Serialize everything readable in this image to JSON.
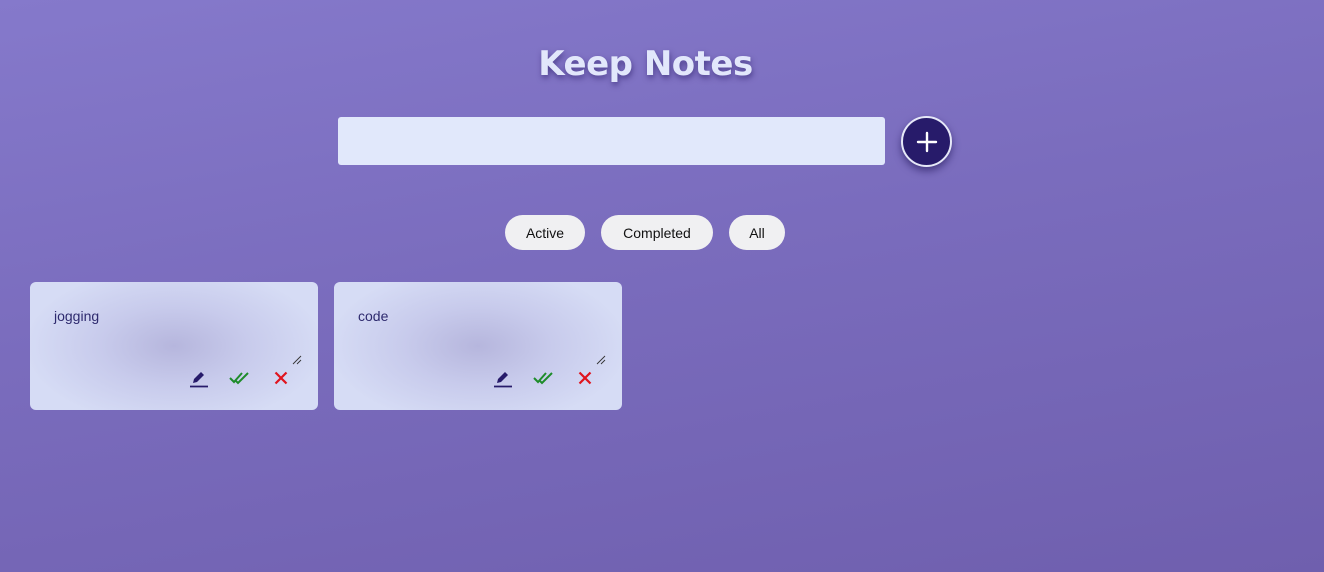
{
  "header": {
    "title": "Keep Notes"
  },
  "new_note": {
    "value": "",
    "placeholder": ""
  },
  "add_button": {
    "icon": "plus-icon"
  },
  "filters": [
    {
      "label": "Active"
    },
    {
      "label": "Completed"
    },
    {
      "label": "All"
    }
  ],
  "notes": [
    {
      "text": "jogging",
      "actions": [
        "edit-icon",
        "double-check-icon",
        "close-icon"
      ]
    },
    {
      "text": "code",
      "actions": [
        "edit-icon",
        "double-check-icon",
        "close-icon"
      ]
    }
  ],
  "colors": {
    "background_top": "#8579cb",
    "background_bottom": "#6f5fae",
    "accent": "#271b6a",
    "complete": "#1e8c2a",
    "delete": "#e0141e",
    "card": "#d6dcf5"
  }
}
